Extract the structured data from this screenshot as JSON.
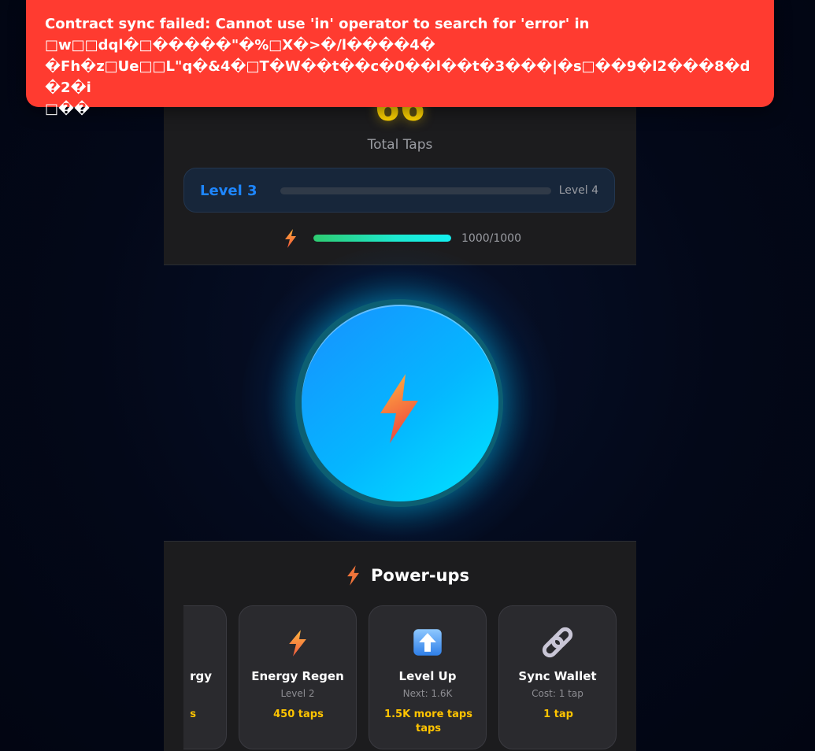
{
  "stats": {
    "tap_count": "66",
    "tap_label": "Total Taps",
    "energy_text": "1000/1000",
    "energy_fraction": 1.0
  },
  "level": {
    "current": "Level 3",
    "next": "Level 4",
    "progress_fraction": 0.0
  },
  "tap_button": {
    "icon": "lightning-bolt-icon"
  },
  "powerups": {
    "title": "Power-ups",
    "icon": "lightning-bolt-icon",
    "items": [
      {
        "name": "rgy",
        "sub": "",
        "cost": "s"
      },
      {
        "name": "Energy Regen",
        "sub": "Level 2",
        "cost": "450 taps",
        "icon": "lightning-bolt-icon"
      },
      {
        "name": "Level Up",
        "sub": "Next: 1.6K",
        "cost": "1.5K more taps",
        "cost_line2": "taps",
        "icon": "up-arrow-icon"
      },
      {
        "name": "Sync Wallet",
        "sub": "Cost: 1 tap",
        "cost": "1 tap",
        "icon": "link-icon"
      }
    ]
  },
  "toast": {
    "line1": "Contract sync failed: Cannot use 'in' operator to search for 'error' in",
    "line2": "□w□□dql�□�����\"�%□X�>�/l����4�",
    "line3": "�Fh�z□Ue□□L\"q�&4�□T�W��t��c�0��l��t�3���|�s□��9�l2���8�d�2�i",
    "line4": "□��"
  },
  "colors": {
    "accent_blue": "#1e86ff",
    "gold": "#ffd400",
    "error_red": "#ff3b30",
    "panel": "#1c1c1e"
  }
}
